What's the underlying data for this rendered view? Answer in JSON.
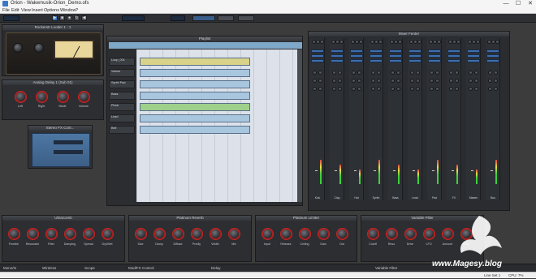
{
  "window": {
    "title": "Orion - Wakemusik-Orion_Demo.ofs",
    "min": "—",
    "max": "☐",
    "close": "✕"
  },
  "menu": [
    "File",
    "Edit",
    "View",
    "Insert",
    "Options",
    "Window",
    "?"
  ],
  "transport": {
    "tempo": "",
    "bars": "",
    "mode_a": "",
    "mode_b": "",
    "master_label": ""
  },
  "panels": {
    "rack": {
      "title": "Rockerstr Looder 1 - 1"
    },
    "analog_delay": {
      "title": "Analog Delay 1 (Sub 01)",
      "knobs": [
        {
          "label": "Left",
          "value": ""
        },
        {
          "label": "Right",
          "value": ""
        },
        {
          "label": "Mode",
          "value": ""
        },
        {
          "label": "Volume",
          "value": ""
        }
      ]
    },
    "stereo_fx": {
      "title": "Stereo FX Cont..."
    },
    "playlist": {
      "title": "Playlist",
      "tracks": [
        "Loop_001",
        "Voices",
        "Synth Pad",
        "Bass",
        "Pluck",
        "Lead",
        "Bell"
      ]
    },
    "mixer": {
      "title": "Mixer Fenter",
      "channels": [
        "Kick",
        "Clap",
        "Hat",
        "Synth",
        "Bass",
        "Lead",
        "Pad",
        "FX",
        "Master",
        "Bus"
      ]
    },
    "ultra_comb": {
      "title": "UltraComb",
      "knobs": [
        "Feedbk",
        "Resonator",
        "Filter",
        "Damping",
        "Spread",
        "Dry/Wet"
      ]
    },
    "platinum_reverb": {
      "title": "Platinum Reverb",
      "knobs": [
        "Size",
        "Damp",
        "Diffuse",
        "Predly",
        "Width",
        "Mix"
      ]
    },
    "platinum_limiter": {
      "title": "Platinum Limiter",
      "knobs": [
        "Input",
        "Release",
        "Ceiling",
        "Gain",
        "Out"
      ]
    },
    "variable_filter": {
      "title": "Variable Filter",
      "knobs": [
        "Cutoff",
        "Reso",
        "Drive",
        "LFO",
        "Amount",
        "Rate"
      ]
    }
  },
  "dock": [
    "Mono/In",
    "Wireless",
    "Scope",
    "Mod/FX Control",
    "Delay",
    "Variable Filter"
  ],
  "status": {
    "left": "",
    "right": "CPU: 7%",
    "mid": "Line Set 1"
  },
  "watermark": "www.Magesy.blog",
  "colors": {
    "accent": "#3b78c4",
    "grid": "#dde2ea",
    "clip_yellow": "#d9d38a",
    "clip_blue": "#a9c6df",
    "clip_green": "#9ed08b"
  }
}
